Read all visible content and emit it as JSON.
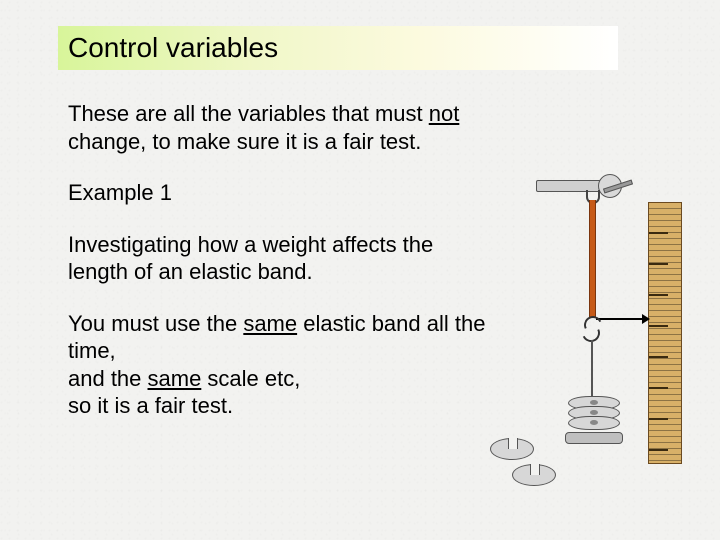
{
  "title": "Control variables",
  "p1_a": "These are all the variables that must ",
  "p1_u": "not",
  "p1_b": " change, to make sure it is a fair test.",
  "p2": "Example 1",
  "p3": "Investigating how a weight affects the length of an elastic band.",
  "p4_a": "You must use the ",
  "p4_u1": "same",
  "p4_b": " elastic band all the time,",
  "p4_c": "and the ",
  "p4_u2": "same",
  "p4_d": " scale etc,",
  "p4_e": "so it is a fair test."
}
